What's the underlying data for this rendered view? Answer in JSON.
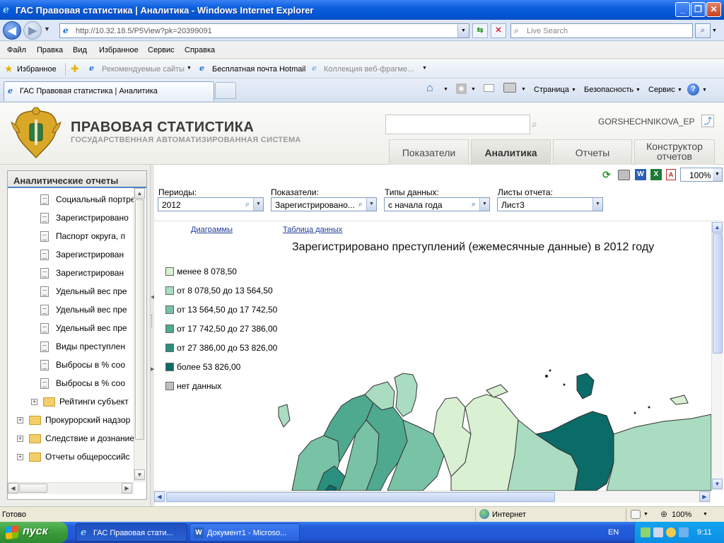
{
  "window": {
    "title": "ГАС Правовая статистика | Аналитика - Windows Internet Explorer"
  },
  "addressbar": {
    "url": "http://10.32.18.5/P5View?pk=20399091",
    "search_placeholder": "Live Search"
  },
  "menu": [
    "Файл",
    "Правка",
    "Вид",
    "Избранное",
    "Сервис",
    "Справка"
  ],
  "favorites": {
    "label": "Избранное",
    "items": [
      "Рекомендуемые сайты",
      "Бесплатная почта Hotmail",
      "Коллекция веб-фрагме..."
    ]
  },
  "tab": {
    "title": "ГАС Правовая статистика | Аналитика",
    "commands": [
      "Страница",
      "Безопасность",
      "Сервис"
    ]
  },
  "site": {
    "title": "ПРАВОВАЯ СТАТИСТИКА",
    "subtitle": "ГОСУДАРСТВЕННАЯ АВТОМАТИЗИРОВАННАЯ СИСТЕМА",
    "username": "GORSHECHNIKOVA_EP",
    "tabs": [
      "Показатели",
      "Аналитика",
      "Отчеты",
      "Конструктор отчетов"
    ],
    "active_tab": "Аналитика"
  },
  "sidebar": {
    "header": "Аналитические отчеты",
    "items": [
      {
        "label": "Социальный портрет",
        "type": "doc"
      },
      {
        "label": "Зарегистрировано",
        "type": "doc"
      },
      {
        "label": "Паспорт округа, п",
        "type": "doc"
      },
      {
        "label": "Зарегистрирован",
        "type": "doc"
      },
      {
        "label": "Зарегистрирован",
        "type": "doc"
      },
      {
        "label": "Удельный вес пре",
        "type": "doc"
      },
      {
        "label": "Удельный вес пре",
        "type": "doc"
      },
      {
        "label": "Удельный вес пре",
        "type": "doc"
      },
      {
        "label": "Виды преступлен",
        "type": "doc"
      },
      {
        "label": "Выбросы в % соо",
        "type": "doc"
      },
      {
        "label": "Выбросы в % соо",
        "type": "doc"
      },
      {
        "label": "Рейтинги субъект",
        "type": "folder"
      },
      {
        "label": "Прокурорский надзор",
        "type": "folder"
      },
      {
        "label": "Следствие и дознание",
        "type": "folder"
      },
      {
        "label": "Отчеты общероссийс",
        "type": "folder"
      }
    ]
  },
  "toolbar": {
    "zoom": "100%"
  },
  "filters": [
    {
      "label": "Периоды:",
      "value": "2012"
    },
    {
      "label": "Показатели:",
      "value": "Зарегистрировано..."
    },
    {
      "label": "Типы данных:",
      "value": "с начала года"
    },
    {
      "label": "Листы отчета:",
      "value": "Лист3"
    }
  ],
  "links": {
    "charts": "Диаграммы",
    "table": "Таблица данных"
  },
  "map": {
    "title": "Зарегистрировано преступлений (ежемесячные данные) в 2012 году",
    "legend": [
      {
        "label": "менее 8 078,50",
        "color": "#d9f0d3"
      },
      {
        "label": "от 8 078,50 до 13 564,50",
        "color": "#a9dcc0"
      },
      {
        "label": "от 13 564,50 до 17 742,50",
        "color": "#78c2a6"
      },
      {
        "label": "от 17 742,50 до 27 386,00",
        "color": "#4fa98f"
      },
      {
        "label": "от 27 386,00 до 53 826,00",
        "color": "#2b8f7e"
      },
      {
        "label": "более 53 826,00",
        "color": "#0b6b68"
      },
      {
        "label": "нет данных",
        "color": "#c0c0c0"
      }
    ]
  },
  "status": {
    "left": "Готово",
    "zone": "Интернет",
    "zoom": "100%"
  },
  "taskbar": {
    "start": "пуск",
    "tasks": [
      "ГАС Правовая стати...",
      "Документ1 - Microso..."
    ],
    "lang": "EN",
    "time": "9:11"
  }
}
